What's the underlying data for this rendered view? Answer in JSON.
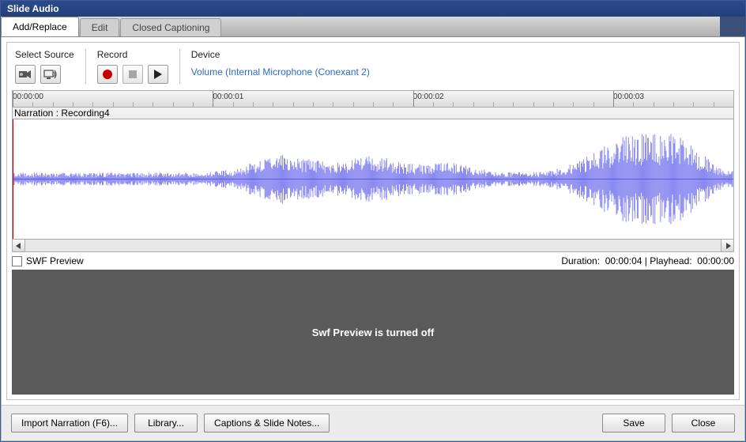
{
  "window": {
    "title": "Slide Audio"
  },
  "tabs": [
    {
      "label": "Add/Replace",
      "active": true
    },
    {
      "label": "Edit",
      "active": false
    },
    {
      "label": "Closed Captioning",
      "active": false
    }
  ],
  "toolbar": {
    "source": {
      "label": "Select Source"
    },
    "record": {
      "label": "Record"
    },
    "device": {
      "label": "Device",
      "link": "Volume (Internal Microphone (Conexant 2)"
    }
  },
  "timeline": {
    "ticks": [
      "00:00:00",
      "00:00:01",
      "00:00:02",
      "00:00:03"
    ],
    "track_label": "Narration : Recording4"
  },
  "info": {
    "swf_checkbox_label": "SWF Preview",
    "swf_checked": false,
    "duration_label": "Duration:",
    "duration_value": "00:00:04",
    "playhead_label": "Playhead:",
    "playhead_value": "00:00:00"
  },
  "preview": {
    "message": "Swf Preview is turned off"
  },
  "footer": {
    "import": "Import Narration (F6)...",
    "library": "Library...",
    "captions": "Captions & Slide Notes...",
    "save": "Save",
    "close": "Close"
  }
}
